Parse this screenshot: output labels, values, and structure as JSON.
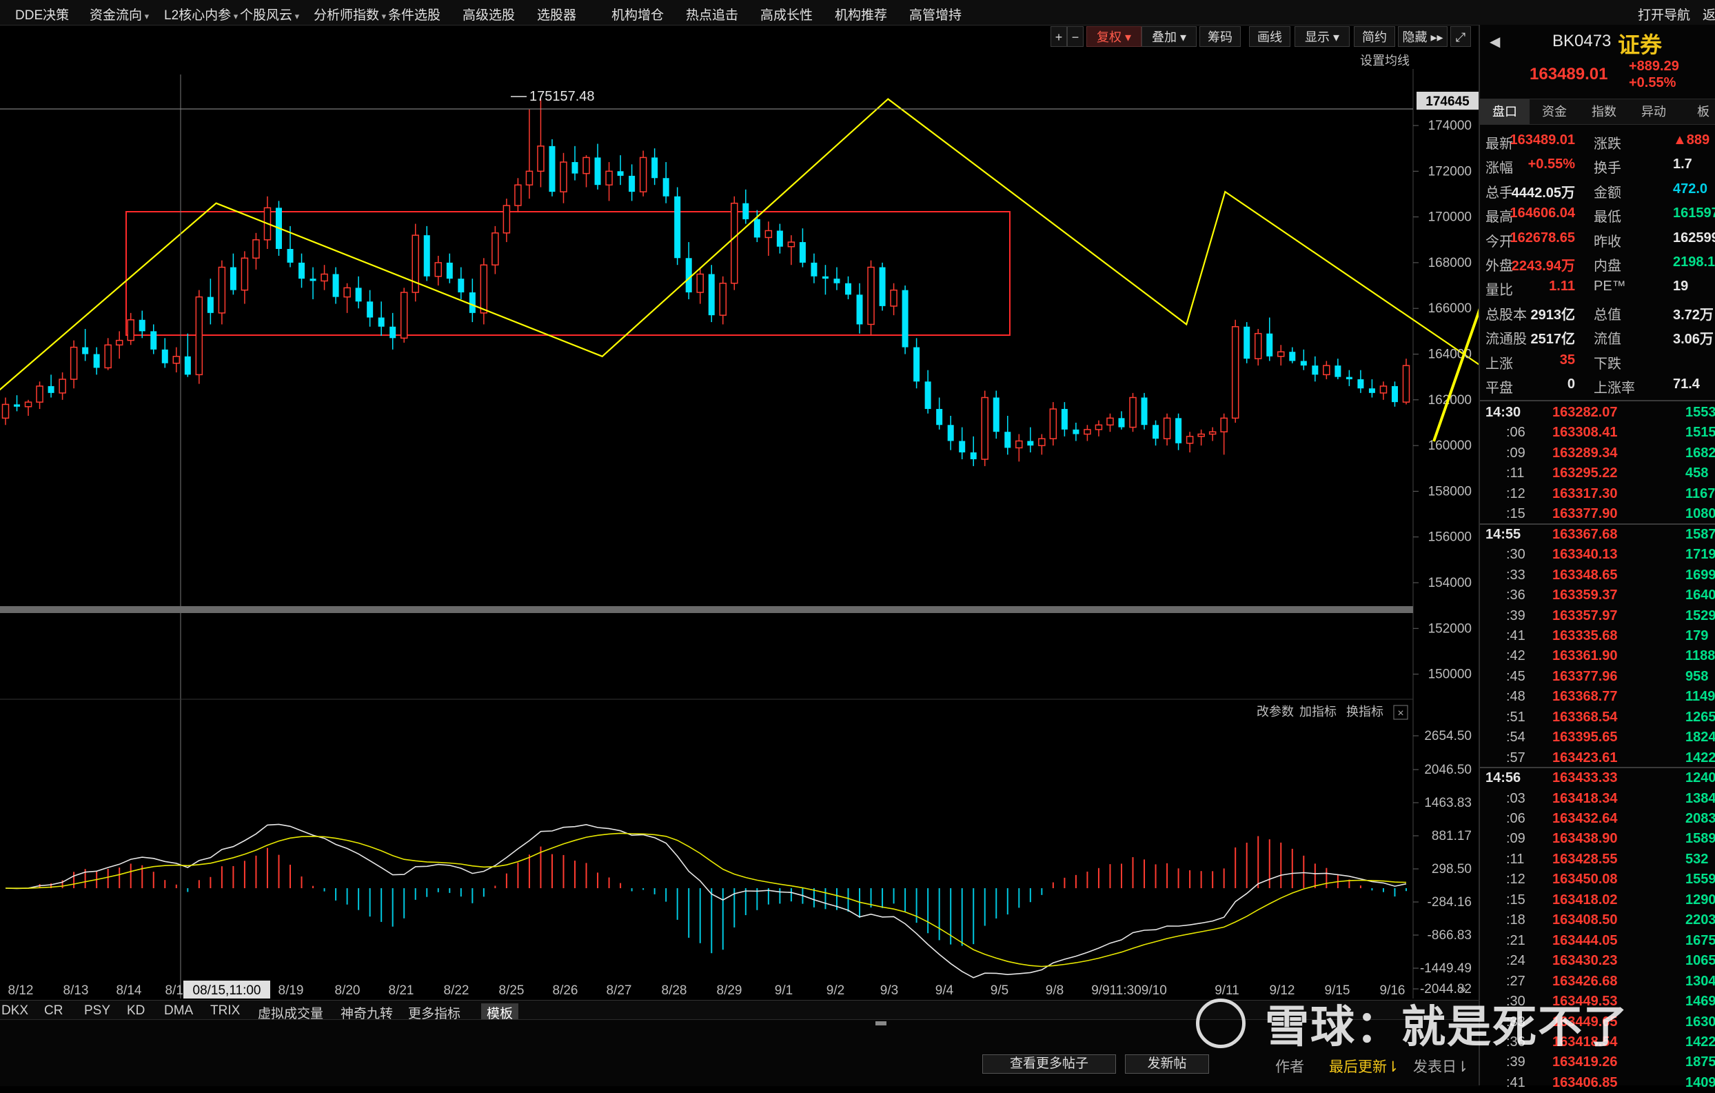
{
  "menu": [
    "DDE决策",
    "资金流向",
    "L2核心内参",
    "个股风云",
    "分析师指数",
    "条件选股",
    "高级选股",
    "选股器",
    "机构增仓",
    "热点追击",
    "高成长性",
    "机构推荐",
    "高管增持"
  ],
  "menu_dropdown": [
    false,
    true,
    true,
    true,
    true,
    false,
    false,
    false,
    false,
    false,
    false,
    false,
    false
  ],
  "menu_right": [
    "打开导航",
    "返"
  ],
  "toolbar": {
    "plus": "+",
    "minus": "−",
    "fuquan": "复权",
    "overlay": "叠加",
    "chips": "筹码",
    "draw": "画线",
    "display": "显示",
    "simple": "简约",
    "hide": "隐藏",
    "ma_setting": "设置均线"
  },
  "chart": {
    "high_label": "175157.48",
    "current_price_tag": "174645",
    "price_axis": [
      "174000",
      "172000",
      "170000",
      "168000",
      "166000",
      "164000",
      "162000",
      "160000",
      "158000",
      "156000",
      "154000",
      "152000",
      "150000"
    ],
    "date_axis": [
      "8/12",
      "8/13",
      "8/14",
      "8/15",
      "8/19",
      "8/20",
      "8/21",
      "8/22",
      "8/25",
      "8/26",
      "8/27",
      "8/28",
      "8/29",
      "9/1",
      "9/2",
      "9/3",
      "9/4",
      "9/5",
      "9/8",
      "9/911:309/10",
      "9/11",
      "9/12",
      "9/15",
      "9/16"
    ],
    "crosshair_label": "08/15,11:00",
    "candles": [
      [
        161200,
        162100,
        160900,
        161800
      ],
      [
        161800,
        162200,
        161500,
        161700
      ],
      [
        161700,
        162000,
        161300,
        161900
      ],
      [
        161900,
        162800,
        161600,
        162600
      ],
      [
        162600,
        163100,
        162100,
        162300
      ],
      [
        162300,
        163200,
        162000,
        162900
      ],
      [
        162900,
        164600,
        162500,
        164300
      ],
      [
        164300,
        165100,
        163700,
        164000
      ],
      [
        164000,
        164300,
        163100,
        163400
      ],
      [
        163400,
        164700,
        163300,
        164400
      ],
      [
        164400,
        165000,
        163800,
        164600
      ],
      [
        164600,
        165800,
        164400,
        165500
      ],
      [
        165500,
        165900,
        164700,
        165000
      ],
      [
        165000,
        165300,
        164000,
        164200
      ],
      [
        164200,
        164700,
        163400,
        163600
      ],
      [
        163600,
        164300,
        163200,
        163900
      ],
      [
        163900,
        164900,
        163000,
        163100
      ],
      [
        163100,
        166800,
        162700,
        166500
      ],
      [
        166500,
        167300,
        165300,
        165800
      ],
      [
        165800,
        168100,
        165300,
        167800
      ],
      [
        167800,
        168400,
        166600,
        166800
      ],
      [
        166800,
        168500,
        166200,
        168200
      ],
      [
        168200,
        169300,
        167700,
        169000
      ],
      [
        169000,
        170900,
        168600,
        170400
      ],
      [
        170400,
        170700,
        168300,
        168600
      ],
      [
        168600,
        169600,
        167800,
        168000
      ],
      [
        168000,
        168400,
        166900,
        167300
      ],
      [
        167300,
        167800,
        166400,
        167200
      ],
      [
        167200,
        167900,
        166800,
        167500
      ],
      [
        167500,
        167800,
        166200,
        166500
      ],
      [
        166500,
        167100,
        165800,
        166900
      ],
      [
        166900,
        167400,
        166000,
        166300
      ],
      [
        166300,
        166800,
        165200,
        165600
      ],
      [
        165600,
        166300,
        164800,
        165200
      ],
      [
        165200,
        165800,
        164200,
        164700
      ],
      [
        164700,
        166900,
        164500,
        166700
      ],
      [
        166700,
        169700,
        166300,
        169200
      ],
      [
        169200,
        169600,
        167200,
        167400
      ],
      [
        167400,
        168300,
        167000,
        168000
      ],
      [
        168000,
        168400,
        167100,
        167300
      ],
      [
        167300,
        167800,
        166400,
        166700
      ],
      [
        166700,
        167300,
        165400,
        165800
      ],
      [
        165800,
        168200,
        165300,
        167900
      ],
      [
        167900,
        169600,
        167500,
        169300
      ],
      [
        169300,
        170800,
        168900,
        170500
      ],
      [
        170500,
        171700,
        170200,
        171400
      ],
      [
        171400,
        174700,
        170800,
        172000
      ],
      [
        172000,
        175157,
        171300,
        173100
      ],
      [
        173100,
        173400,
        170900,
        171100
      ],
      [
        171100,
        172800,
        170600,
        172400
      ],
      [
        172400,
        173100,
        171600,
        171900
      ],
      [
        171900,
        172700,
        171300,
        172600
      ],
      [
        172600,
        173200,
        171200,
        171400
      ],
      [
        171400,
        172400,
        170700,
        172000
      ],
      [
        172000,
        172700,
        171400,
        171800
      ],
      [
        171800,
        172300,
        170700,
        171100
      ],
      [
        171100,
        172900,
        170900,
        172600
      ],
      [
        172600,
        173000,
        171400,
        171700
      ],
      [
        171700,
        172400,
        170600,
        170900
      ],
      [
        170900,
        171300,
        167900,
        168200
      ],
      [
        168200,
        168900,
        166400,
        166700
      ],
      [
        166700,
        167800,
        166200,
        167500
      ],
      [
        167500,
        167900,
        165400,
        165700
      ],
      [
        165700,
        167400,
        165300,
        167100
      ],
      [
        167100,
        170900,
        166800,
        170600
      ],
      [
        170600,
        171200,
        169700,
        169900
      ],
      [
        169900,
        170300,
        168900,
        169100
      ],
      [
        169100,
        169800,
        168300,
        169400
      ],
      [
        169400,
        169700,
        168400,
        168700
      ],
      [
        168700,
        169200,
        167900,
        168900
      ],
      [
        168900,
        169500,
        167800,
        168000
      ],
      [
        168000,
        168400,
        167100,
        167400
      ],
      [
        167400,
        167900,
        166600,
        167300
      ],
      [
        167300,
        167800,
        166800,
        167100
      ],
      [
        167100,
        167400,
        166400,
        166600
      ],
      [
        166600,
        167100,
        164900,
        165300
      ],
      [
        165300,
        168100,
        164800,
        167800
      ],
      [
        167800,
        168000,
        165900,
        166100
      ],
      [
        166100,
        167100,
        165700,
        166800
      ],
      [
        166800,
        167000,
        164000,
        164300
      ],
      [
        164300,
        164700,
        162500,
        162800
      ],
      [
        162800,
        163300,
        161400,
        161600
      ],
      [
        161600,
        162100,
        160700,
        160900
      ],
      [
        160900,
        161300,
        159800,
        160200
      ],
      [
        160200,
        160800,
        159400,
        159700
      ],
      [
        159700,
        160400,
        159100,
        159400
      ],
      [
        159400,
        162400,
        159100,
        162100
      ],
      [
        162100,
        162400,
        160300,
        160600
      ],
      [
        160600,
        161300,
        159600,
        159900
      ],
      [
        159900,
        160500,
        159300,
        160200
      ],
      [
        160200,
        160800,
        159700,
        160000
      ],
      [
        160000,
        160500,
        159600,
        160300
      ],
      [
        160300,
        161900,
        160000,
        161600
      ],
      [
        161600,
        161900,
        160400,
        160700
      ],
      [
        160700,
        161000,
        160200,
        160500
      ],
      [
        160500,
        160900,
        160200,
        160700
      ],
      [
        160700,
        161100,
        160400,
        160900
      ],
      [
        160900,
        161400,
        160600,
        161200
      ],
      [
        161200,
        161500,
        160700,
        160800
      ],
      [
        160800,
        162300,
        160600,
        162100
      ],
      [
        162100,
        162300,
        160700,
        160900
      ],
      [
        160900,
        161100,
        160000,
        160300
      ],
      [
        160300,
        161400,
        160000,
        161200
      ],
      [
        161200,
        161400,
        159800,
        160100
      ],
      [
        160100,
        160600,
        159700,
        160400
      ],
      [
        160400,
        160700,
        160000,
        160500
      ],
      [
        160500,
        160800,
        160200,
        160600
      ],
      [
        160600,
        161400,
        159600,
        161200
      ],
      [
        161200,
        165500,
        161000,
        165200
      ],
      [
        165200,
        165400,
        163600,
        163800
      ],
      [
        163800,
        165100,
        163500,
        164900
      ],
      [
        164900,
        165600,
        163700,
        163900
      ],
      [
        163900,
        164400,
        163500,
        164100
      ],
      [
        164100,
        164300,
        163600,
        163700
      ],
      [
        163700,
        164200,
        163300,
        163500
      ],
      [
        163500,
        163900,
        162800,
        163100
      ],
      [
        163100,
        163700,
        162900,
        163500
      ],
      [
        163500,
        163800,
        162900,
        163000
      ],
      [
        163000,
        163300,
        162600,
        162900
      ],
      [
        162900,
        163300,
        162300,
        162500
      ],
      [
        162500,
        162900,
        162100,
        162300
      ],
      [
        162300,
        162800,
        162000,
        162600
      ],
      [
        162600,
        162800,
        161700,
        161900
      ],
      [
        161900,
        163800,
        161800,
        163500
      ]
    ],
    "zigzag": [
      [
        161800,
        -2
      ],
      [
        170600,
        18.5
      ],
      [
        163900,
        52.4
      ],
      [
        175157,
        77.5
      ],
      [
        165300,
        103.7
      ],
      [
        171100,
        107.1
      ],
      [
        159000,
        142.8
      ],
      [
        165600,
        189.6
      ],
      [
        161700,
        208.3
      ],
      [
        167100,
        222
      ]
    ],
    "macd": {
      "axis": [
        "2654.50",
        "2046.50",
        "1463.83",
        "881.17",
        "298.50",
        "-284.16",
        "-866.83",
        "-1449.49",
        "-2044.82"
      ],
      "buttons": [
        "改参数",
        "加指标",
        "换指标"
      ]
    }
  },
  "right_panel": {
    "code": "BK0473",
    "name": "证券",
    "price": "163489.01",
    "change": "+889.29",
    "change_pct": "+0.55%",
    "tabs": [
      "盘口",
      "资金",
      "指数",
      "异动",
      "板"
    ],
    "quotes": [
      [
        "最新",
        "163489.01",
        "red",
        "涨跌",
        "▲889",
        "red"
      ],
      [
        "涨幅",
        "+0.55%",
        "red",
        "换手",
        "1.7",
        "wht"
      ],
      [
        "总手",
        "4442.05万",
        "wht",
        "金额",
        "472.0",
        "cyn"
      ],
      [
        "最高",
        "164606.04",
        "red",
        "最低",
        "161597",
        "grn"
      ],
      [
        "今开",
        "162678.65",
        "red",
        "昨收",
        "162599",
        "wht"
      ],
      [
        "外盘",
        "2243.94万",
        "red",
        "内盘",
        "2198.1",
        "grn"
      ],
      [
        "量比",
        "1.11",
        "red",
        "PE™",
        "19",
        "wht"
      ],
      [
        "总股本",
        "2913亿",
        "wht",
        "总值",
        "3.72万",
        "wht"
      ],
      [
        "流通股",
        "2517亿",
        "wht",
        "流值",
        "3.06万",
        "wht"
      ],
      [
        "上涨",
        "35",
        "red",
        "下跌",
        "",
        "wht"
      ],
      [
        "平盘",
        "0",
        "wht",
        "上涨率",
        "71.4",
        "wht"
      ]
    ],
    "ticks": [
      {
        "t": "14:30",
        "p": "163282.07",
        "v": "1553",
        "big": true
      },
      {
        "t": ":06",
        "p": "163308.41",
        "v": "1515"
      },
      {
        "t": ":09",
        "p": "163289.34",
        "v": "1682"
      },
      {
        "t": ":11",
        "p": "163295.22",
        "v": "458"
      },
      {
        "t": ":12",
        "p": "163317.30",
        "v": "1167"
      },
      {
        "t": ":15",
        "p": "163377.90",
        "v": "1080"
      },
      {
        "t": "14:55",
        "p": "163367.68",
        "v": "1587",
        "big": true,
        "sep": true
      },
      {
        "t": ":30",
        "p": "163340.13",
        "v": "1719"
      },
      {
        "t": ":33",
        "p": "163348.65",
        "v": "1699"
      },
      {
        "t": ":36",
        "p": "163359.37",
        "v": "1640"
      },
      {
        "t": ":39",
        "p": "163357.97",
        "v": "1529"
      },
      {
        "t": ":41",
        "p": "163335.68",
        "v": "179"
      },
      {
        "t": ":42",
        "p": "163361.90",
        "v": "1188"
      },
      {
        "t": ":45",
        "p": "163377.96",
        "v": "958"
      },
      {
        "t": ":48",
        "p": "163368.77",
        "v": "1149"
      },
      {
        "t": ":51",
        "p": "163368.54",
        "v": "1265"
      },
      {
        "t": ":54",
        "p": "163395.65",
        "v": "1824"
      },
      {
        "t": ":57",
        "p": "163423.61",
        "v": "1422"
      },
      {
        "t": "14:56",
        "p": "163433.33",
        "v": "1240",
        "big": true,
        "sep": true
      },
      {
        "t": ":03",
        "p": "163418.34",
        "v": "1384"
      },
      {
        "t": ":06",
        "p": "163432.64",
        "v": "2083"
      },
      {
        "t": ":09",
        "p": "163438.90",
        "v": "1589"
      },
      {
        "t": ":11",
        "p": "163428.55",
        "v": "532"
      },
      {
        "t": ":12",
        "p": "163450.08",
        "v": "1559"
      },
      {
        "t": ":15",
        "p": "163418.02",
        "v": "1290"
      },
      {
        "t": ":18",
        "p": "163408.50",
        "v": "2203"
      },
      {
        "t": ":21",
        "p": "163444.05",
        "v": "1675"
      },
      {
        "t": ":24",
        "p": "163430.23",
        "v": "1065"
      },
      {
        "t": ":27",
        "p": "163426.68",
        "v": "1304"
      },
      {
        "t": ":30",
        "p": "163449.53",
        "v": "1469"
      },
      {
        "t": ":33",
        "p": "163449.65",
        "v": "1630"
      },
      {
        "t": ":36",
        "p": "163418.54",
        "v": "1422"
      },
      {
        "t": ":39",
        "p": "163419.26",
        "v": "1875"
      },
      {
        "t": ":41",
        "p": "163406.85",
        "v": "1409"
      }
    ]
  },
  "indicator_tabs": [
    "DKX",
    "CR",
    "PSY",
    "KD",
    "DMA",
    "TRIX",
    "虚拟成交量",
    "神奇九转",
    "更多指标",
    "模板"
  ],
  "bottom": {
    "more_posts": "查看更多帖子",
    "post": "发新帖",
    "author": "作者",
    "last_update": "最后更新⇂",
    "post_date": "发表日⇂"
  },
  "watermark": {
    "brand": "雪球",
    "user": "就是死不了"
  }
}
